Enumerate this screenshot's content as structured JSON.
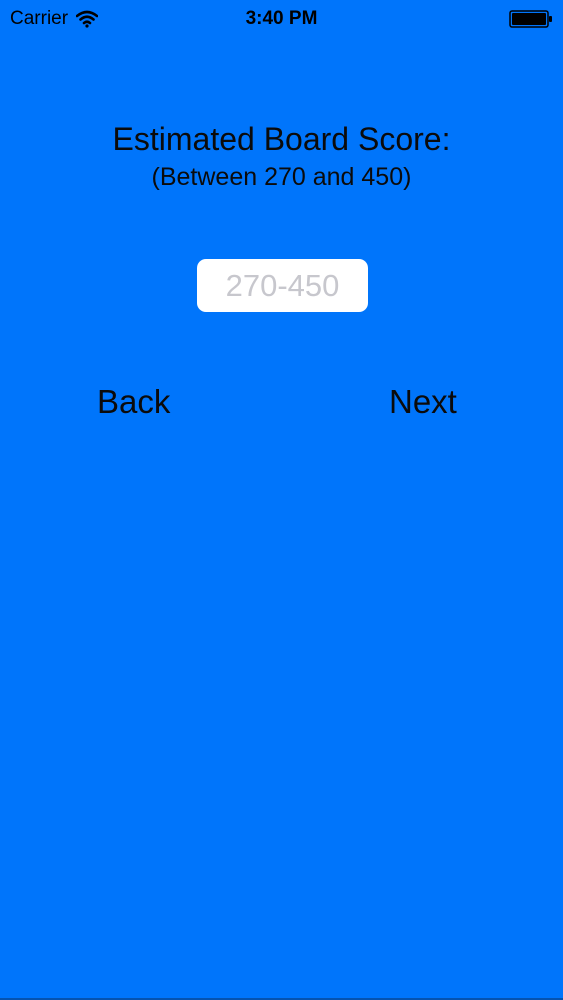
{
  "status_bar": {
    "carrier": "Carrier",
    "time": "3:40 PM",
    "wifi_icon": "wifi-icon",
    "battery_icon": "battery-full-icon"
  },
  "form": {
    "title": "Estimated Board Score:",
    "subtitle": "(Between 270 and 450)",
    "score_input": {
      "value": "",
      "placeholder": "270-450"
    }
  },
  "navigation": {
    "back_label": "Back",
    "next_label": "Next"
  },
  "colors": {
    "background": "#0075fb",
    "text": "#0b0b0b",
    "input_background": "#ffffff",
    "placeholder": "#c7c7cd"
  }
}
